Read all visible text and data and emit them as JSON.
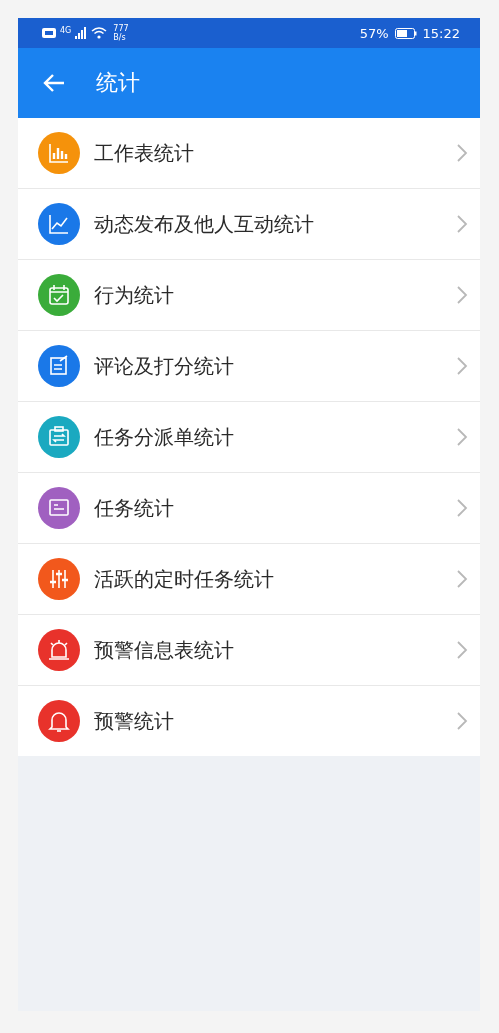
{
  "status_bar": {
    "network": "4G",
    "speed_value": "777",
    "speed_unit": "B/s",
    "battery": "57%",
    "time": "15:22"
  },
  "app_bar": {
    "title": "统计"
  },
  "items": [
    {
      "label": "工作表统计",
      "kind": "bars",
      "color": "#f5920b"
    },
    {
      "label": "动态发布及他人互动统计",
      "kind": "trend",
      "color": "#1a78e8"
    },
    {
      "label": "行为统计",
      "kind": "calendar",
      "color": "#3aac3a"
    },
    {
      "label": "评论及打分统计",
      "kind": "edit",
      "color": "#1a78e8"
    },
    {
      "label": "任务分派单统计",
      "kind": "clipboard",
      "color": "#1aa9c0"
    },
    {
      "label": "任务统计",
      "kind": "task",
      "color": "#a060c0"
    },
    {
      "label": "活跃的定时任务统计",
      "kind": "sliders",
      "color": "#f2581c"
    },
    {
      "label": "预警信息表统计",
      "kind": "alarm",
      "color": "#e8322b"
    },
    {
      "label": "预警统计",
      "kind": "bell",
      "color": "#e8322b"
    }
  ]
}
